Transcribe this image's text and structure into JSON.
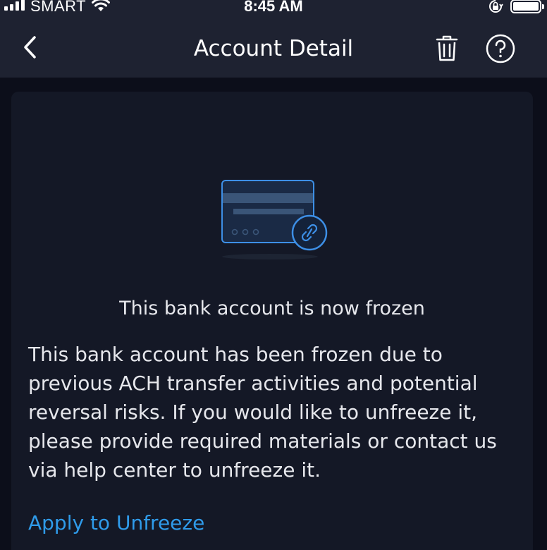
{
  "status_bar": {
    "carrier": "SMART",
    "time": "8:45 AM"
  },
  "header": {
    "title": "Account Detail"
  },
  "content": {
    "heading": "This bank account is now frozen",
    "body": "This bank account has been frozen due to previous ACH transfer activities and potential reversal risks. If you would like to unfreeze it, please provide required materials or contact us via help center to unfreeze it.",
    "link_label": "Apply to Unfreeze"
  },
  "icons": {
    "back": "chevron-left-icon",
    "trash": "trash-icon",
    "help": "question-circle-icon",
    "illustration": "frozen-card-icon"
  },
  "colors": {
    "background": "#0c0e1a",
    "header": "#1e2231",
    "card": "#141826",
    "accent": "#2f9bea",
    "text": "#e6e7ec"
  }
}
